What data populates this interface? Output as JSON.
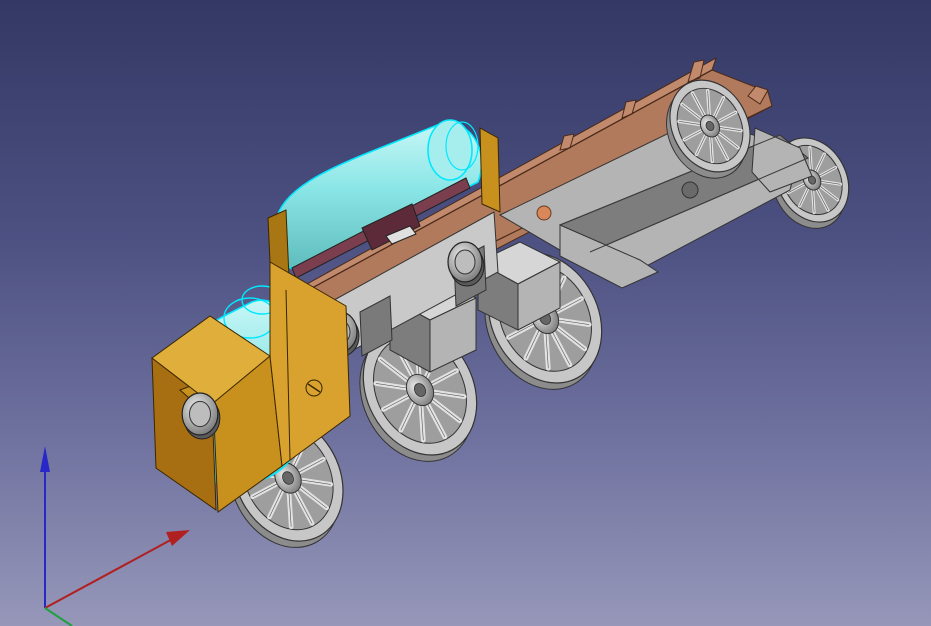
{
  "viewport": {
    "background_top": "#343864",
    "background_bottom": "#9697b9"
  },
  "model": {
    "frame_color": "#b27a5c",
    "frame_top_color": "#c28a6c",
    "bracket_color": "#c8901c",
    "motor_color": "#8ae6e6",
    "motor_highlight": "#00e8ff",
    "gray_part": "#b4b4b4",
    "gray_dark": "#7d7d7d",
    "wheel_color": "#c7c7c7",
    "pcb_color": "#7a3e4e"
  },
  "axis_cross": {
    "x_color": "#b02020",
    "y_color": "#20a040",
    "z_color": "#2828c8",
    "labels": []
  }
}
